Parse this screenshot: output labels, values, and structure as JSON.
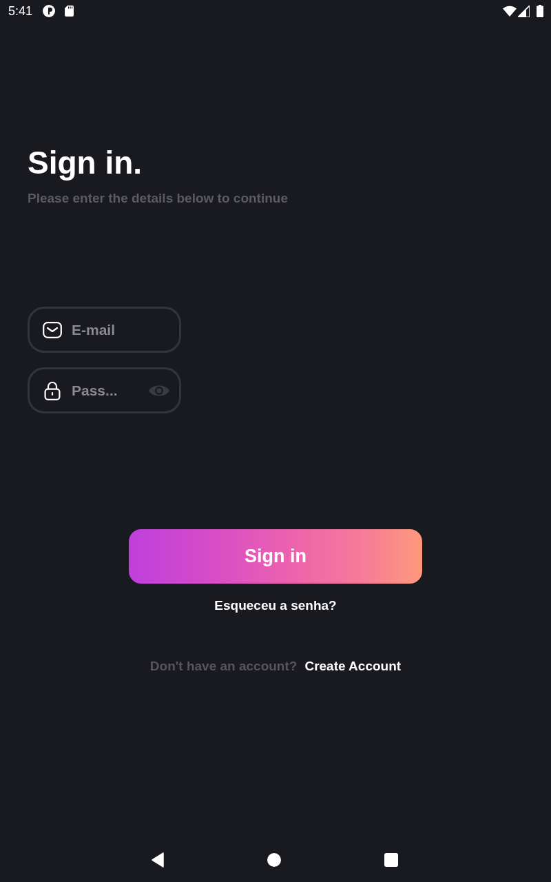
{
  "status_bar": {
    "time": "5:41"
  },
  "header": {
    "title": "Sign in.",
    "subtitle": "Please enter the details below to continue"
  },
  "fields": [
    {
      "kind": "email",
      "placeholder": "E-mail"
    },
    {
      "kind": "password",
      "placeholder": "Pass..."
    }
  ],
  "sign_in_button": {
    "label": "Sign in"
  },
  "forgot_link": {
    "label": "Esqueceu a senha?"
  },
  "signup_prompt": {
    "text": "Don't have an account?",
    "link": "Create Account"
  }
}
